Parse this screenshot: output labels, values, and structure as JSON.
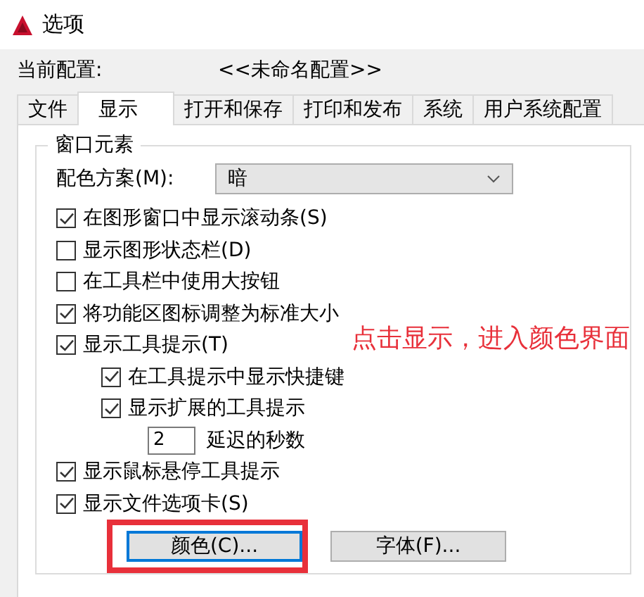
{
  "window": {
    "title": "选项"
  },
  "profile": {
    "label": "当前配置:",
    "value": "<<未命名配置>>"
  },
  "tabs": [
    {
      "label": "文件",
      "selected": false
    },
    {
      "label": "显示",
      "selected": true
    },
    {
      "label": "打开和保存",
      "selected": false
    },
    {
      "label": "打印和发布",
      "selected": false
    },
    {
      "label": "系统",
      "selected": false
    },
    {
      "label": "用户系统配置",
      "selected": false
    }
  ],
  "group": {
    "title": "窗口元素",
    "color_scheme": {
      "label": "配色方案(M):",
      "value": "暗"
    },
    "options": [
      {
        "kind": "checkbox",
        "label": "在图形窗口中显示滚动条(S)",
        "checked": true
      },
      {
        "kind": "checkbox",
        "label": "显示图形状态栏(D)",
        "checked": false
      },
      {
        "kind": "checkbox",
        "label": "在工具栏中使用大按钮",
        "checked": false
      },
      {
        "kind": "checkbox",
        "label": "将功能区图标调整为标准大小",
        "checked": true
      },
      {
        "kind": "checkbox",
        "label": "显示工具提示(T)",
        "checked": true,
        "children": [
          {
            "kind": "checkbox",
            "label": "在工具提示中显示快捷键",
            "checked": true
          },
          {
            "kind": "checkbox",
            "label": "显示扩展的工具提示",
            "checked": true,
            "children": [
              {
                "kind": "spinner",
                "value": "2",
                "label": "延迟的秒数"
              }
            ]
          }
        ]
      },
      {
        "kind": "checkbox",
        "label": "显示鼠标悬停工具提示",
        "checked": true
      },
      {
        "kind": "checkbox",
        "label": "显示文件选项卡(S)",
        "checked": true
      }
    ],
    "buttons": [
      {
        "label": "颜色(C)...",
        "focused": true,
        "marked": true
      },
      {
        "label": "字体(F)...",
        "focused": false,
        "marked": false
      }
    ]
  },
  "annotation": {
    "text": "点击显示，进入颜色界面"
  }
}
